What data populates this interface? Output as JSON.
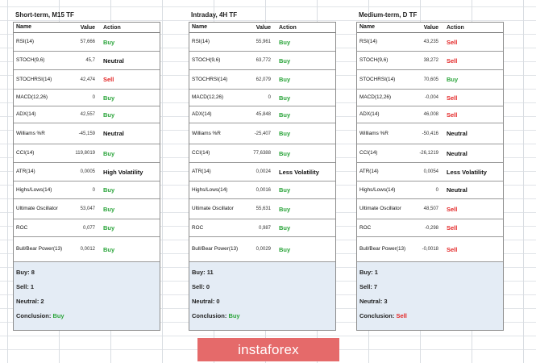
{
  "headers": {
    "name": "Name",
    "value": "Value",
    "action": "Action"
  },
  "panels": [
    {
      "title": "Short-term, M15 TF",
      "rows": [
        {
          "name": "RSI(14)",
          "value": "57,666",
          "action": "Buy",
          "type": "buy"
        },
        {
          "name": "STOCH(9,6)",
          "value": "45,7",
          "action": "Neutral",
          "type": "neutral"
        },
        {
          "name": "STOCHRSI(14)",
          "value": "42,474",
          "action": "Sell",
          "type": "sell"
        },
        {
          "name": "MACD(12,26)",
          "value": "0",
          "action": "Buy",
          "type": "buy"
        },
        {
          "name": "ADX(14)",
          "value": "42,557",
          "action": "Buy",
          "type": "buy"
        },
        {
          "name": "Williams %R",
          "value": "-45,159",
          "action": "Neutral",
          "type": "neutral"
        },
        {
          "name": "CCI(14)",
          "value": "119,8019",
          "action": "Buy",
          "type": "buy"
        },
        {
          "name": "ATR(14)",
          "value": "0,0005",
          "action": "High Volatility",
          "type": "neutral"
        },
        {
          "name": "Highs/Lows(14)",
          "value": "0",
          "action": "Buy",
          "type": "buy"
        },
        {
          "name": "Ultimate Oscillator",
          "value": "53,047",
          "action": "Buy",
          "type": "buy"
        },
        {
          "name": "ROC",
          "value": "0,077",
          "action": "Buy",
          "type": "buy"
        },
        {
          "name": "Bull/Bear Power(13)",
          "value": "0,0012",
          "action": "Buy",
          "type": "buy"
        }
      ],
      "summary": {
        "buy": "Buy: 8",
        "sell": "Sell: 1",
        "neutral": "Neutral: 2",
        "conclusion_label": "Conclusion:",
        "conclusion": "Buy",
        "conclusion_type": "buy"
      }
    },
    {
      "title": "Intraday, 4H TF",
      "rows": [
        {
          "name": "RSI(14)",
          "value": "55,961",
          "action": "Buy",
          "type": "buy"
        },
        {
          "name": "STOCH(9,6)",
          "value": "63,772",
          "action": "Buy",
          "type": "buy"
        },
        {
          "name": "STOCHRSI(14)",
          "value": "62,079",
          "action": "Buy",
          "type": "buy"
        },
        {
          "name": "MACD(12,26)",
          "value": "0",
          "action": "Buy",
          "type": "buy"
        },
        {
          "name": "ADX(14)",
          "value": "45,848",
          "action": "Buy",
          "type": "buy"
        },
        {
          "name": "Williams %R",
          "value": "-25,407",
          "action": "Buy",
          "type": "buy"
        },
        {
          "name": "CCI(14)",
          "value": "77,6388",
          "action": "Buy",
          "type": "buy"
        },
        {
          "name": "ATR(14)",
          "value": "0,0024",
          "action": "Less Volatility",
          "type": "neutral"
        },
        {
          "name": "Highs/Lows(14)",
          "value": "0,0016",
          "action": "Buy",
          "type": "buy"
        },
        {
          "name": "Ultimate Oscillator",
          "value": "55,631",
          "action": "Buy",
          "type": "buy"
        },
        {
          "name": "ROC",
          "value": "0,987",
          "action": "Buy",
          "type": "buy"
        },
        {
          "name": "Bull/Bear Power(13)",
          "value": "0,0029",
          "action": "Buy",
          "type": "buy"
        }
      ],
      "summary": {
        "buy": "Buy: 11",
        "sell": "Sell: 0",
        "neutral": "Neutral: 0",
        "conclusion_label": "Conclusion:",
        "conclusion": "Buy",
        "conclusion_type": "buy"
      }
    },
    {
      "title": "Medium-term, D TF",
      "rows": [
        {
          "name": "RSI(14)",
          "value": "43,235",
          "action": "Sell",
          "type": "sell"
        },
        {
          "name": "STOCH(9,6)",
          "value": "38,272",
          "action": "Sell",
          "type": "sell"
        },
        {
          "name": "STOCHRSI(14)",
          "value": "70,605",
          "action": "Buy",
          "type": "buy"
        },
        {
          "name": "MACD(12,26)",
          "value": "-0,004",
          "action": "Sell",
          "type": "sell"
        },
        {
          "name": "ADX(14)",
          "value": "46,008",
          "action": "Sell",
          "type": "sell"
        },
        {
          "name": "Williams %R",
          "value": "-50,416",
          "action": "Neutral",
          "type": "neutral"
        },
        {
          "name": "CCI(14)",
          "value": "-26,1219",
          "action": "Neutral",
          "type": "neutral"
        },
        {
          "name": "ATR(14)",
          "value": "0,0054",
          "action": "Less Volatility",
          "type": "neutral"
        },
        {
          "name": "Highs/Lows(14)",
          "value": "0",
          "action": "Neutral",
          "type": "neutral"
        },
        {
          "name": "Ultimate Oscillator",
          "value": "48,507",
          "action": "Sell",
          "type": "sell"
        },
        {
          "name": "ROC",
          "value": "-0,298",
          "action": "Sell",
          "type": "sell"
        },
        {
          "name": "Bull/Bear Power(13)",
          "value": "-0,0018",
          "action": "Sell",
          "type": "sell"
        }
      ],
      "summary": {
        "buy": "Buy: 1",
        "sell": "Sell: 7",
        "neutral": "Neutral: 3",
        "conclusion_label": "Conclusion:",
        "conclusion": "Sell",
        "conclusion_type": "sell"
      }
    }
  ],
  "logo": {
    "text": "instaforex"
  },
  "colors": {
    "buy": "#2aa43a",
    "sell": "#e32525",
    "neutral": "#111111",
    "summary_bg": "#e4ecf5",
    "logo_bg": "#e56a6a"
  }
}
